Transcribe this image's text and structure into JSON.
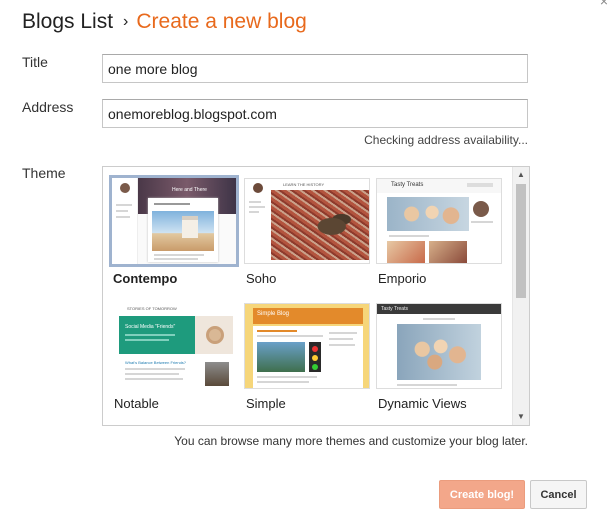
{
  "window": {
    "close_glyph": "×"
  },
  "header": {
    "breadcrumb_parent": "Blogs List",
    "separator": "›",
    "current": "Create a new blog",
    "accent_color": "#e8691c"
  },
  "form": {
    "title_label": "Title",
    "title_value": "one more blog",
    "address_label": "Address",
    "address_value": "onemoreblog.blogspot.com",
    "address_hint": "Checking address availability...",
    "theme_label": "Theme"
  },
  "themes": [
    {
      "name": "Contempo",
      "selected": true
    },
    {
      "name": "Soho",
      "selected": false
    },
    {
      "name": "Emporio",
      "selected": false
    },
    {
      "name": "Notable",
      "selected": false
    },
    {
      "name": "Simple",
      "selected": false
    },
    {
      "name": "Dynamic Views",
      "selected": false
    }
  ],
  "thumbnail_text": {
    "contempo_banner": "Here and There",
    "soho_header": "LEARN THE HISTORY",
    "emporio_title": "Tasty Treats",
    "notable_header": "STORIES OF TOMORROW",
    "notable_hero": "Social Media \"Friends\"",
    "notable_post": "What's Balance Between Friends?",
    "simple_title": "Simple Blog",
    "dynamic_title": "Tasty Treats"
  },
  "scrollbar": {
    "up_glyph": "▲",
    "down_glyph": "▼"
  },
  "footer": {
    "note": "You can browse many more themes and customize your blog later.",
    "create_label": "Create blog!",
    "cancel_label": "Cancel"
  }
}
